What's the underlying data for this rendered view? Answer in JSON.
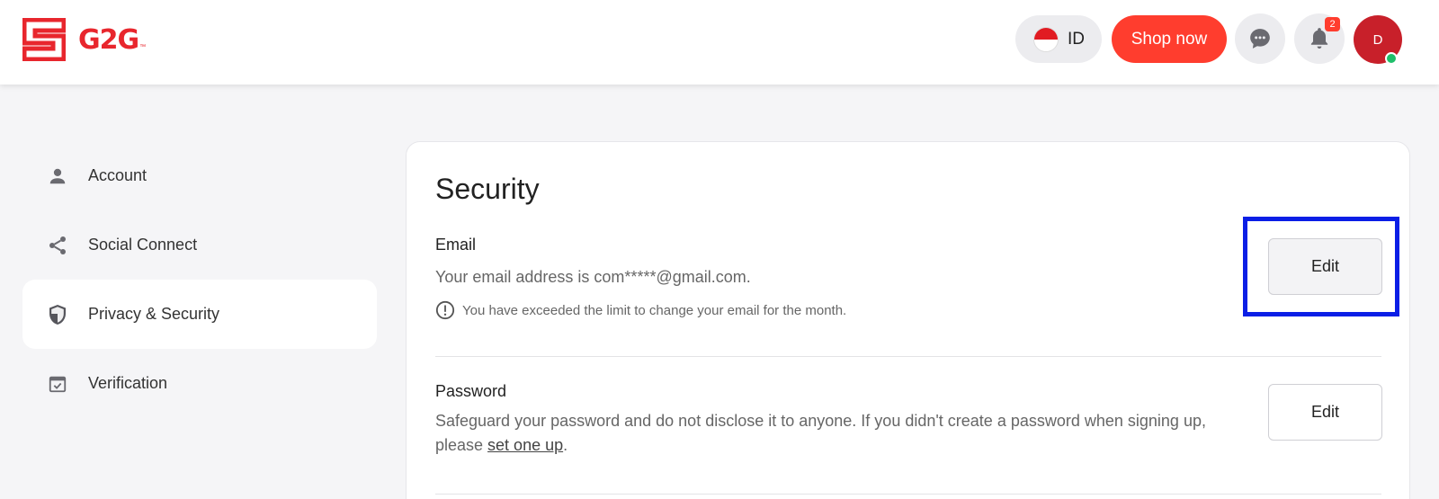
{
  "header": {
    "logo_text": "G2G",
    "logo_tm": "™",
    "language": "ID",
    "shop_label": "Shop now",
    "notification_count": "2",
    "avatar_initial": "D",
    "colors": {
      "brand": "#e8262d",
      "shop": "#ff3d2e",
      "avatar": "#c8202a",
      "online": "#1fbf6a"
    }
  },
  "sidebar": {
    "items": [
      {
        "label": "Account",
        "icon": "person-icon"
      },
      {
        "label": "Social Connect",
        "icon": "share-icon"
      },
      {
        "label": "Privacy & Security",
        "icon": "shield-icon",
        "active": true
      },
      {
        "label": "Verification",
        "icon": "verified-box-icon"
      }
    ]
  },
  "main": {
    "title": "Security",
    "email": {
      "title": "Email",
      "description": "Your email address is com*****@gmail.com.",
      "note": "You have exceeded the limit to change your email for the month.",
      "edit_label": "Edit"
    },
    "password": {
      "title": "Password",
      "description_1": "Safeguard your password and do not disclose it to anyone. If you didn't create a password when signing up,",
      "description_2_prefix": "please ",
      "link_label": "set one up",
      "description_2_suffix": ".",
      "edit_label": "Edit"
    },
    "highlight_color": "#0a1ee6"
  }
}
